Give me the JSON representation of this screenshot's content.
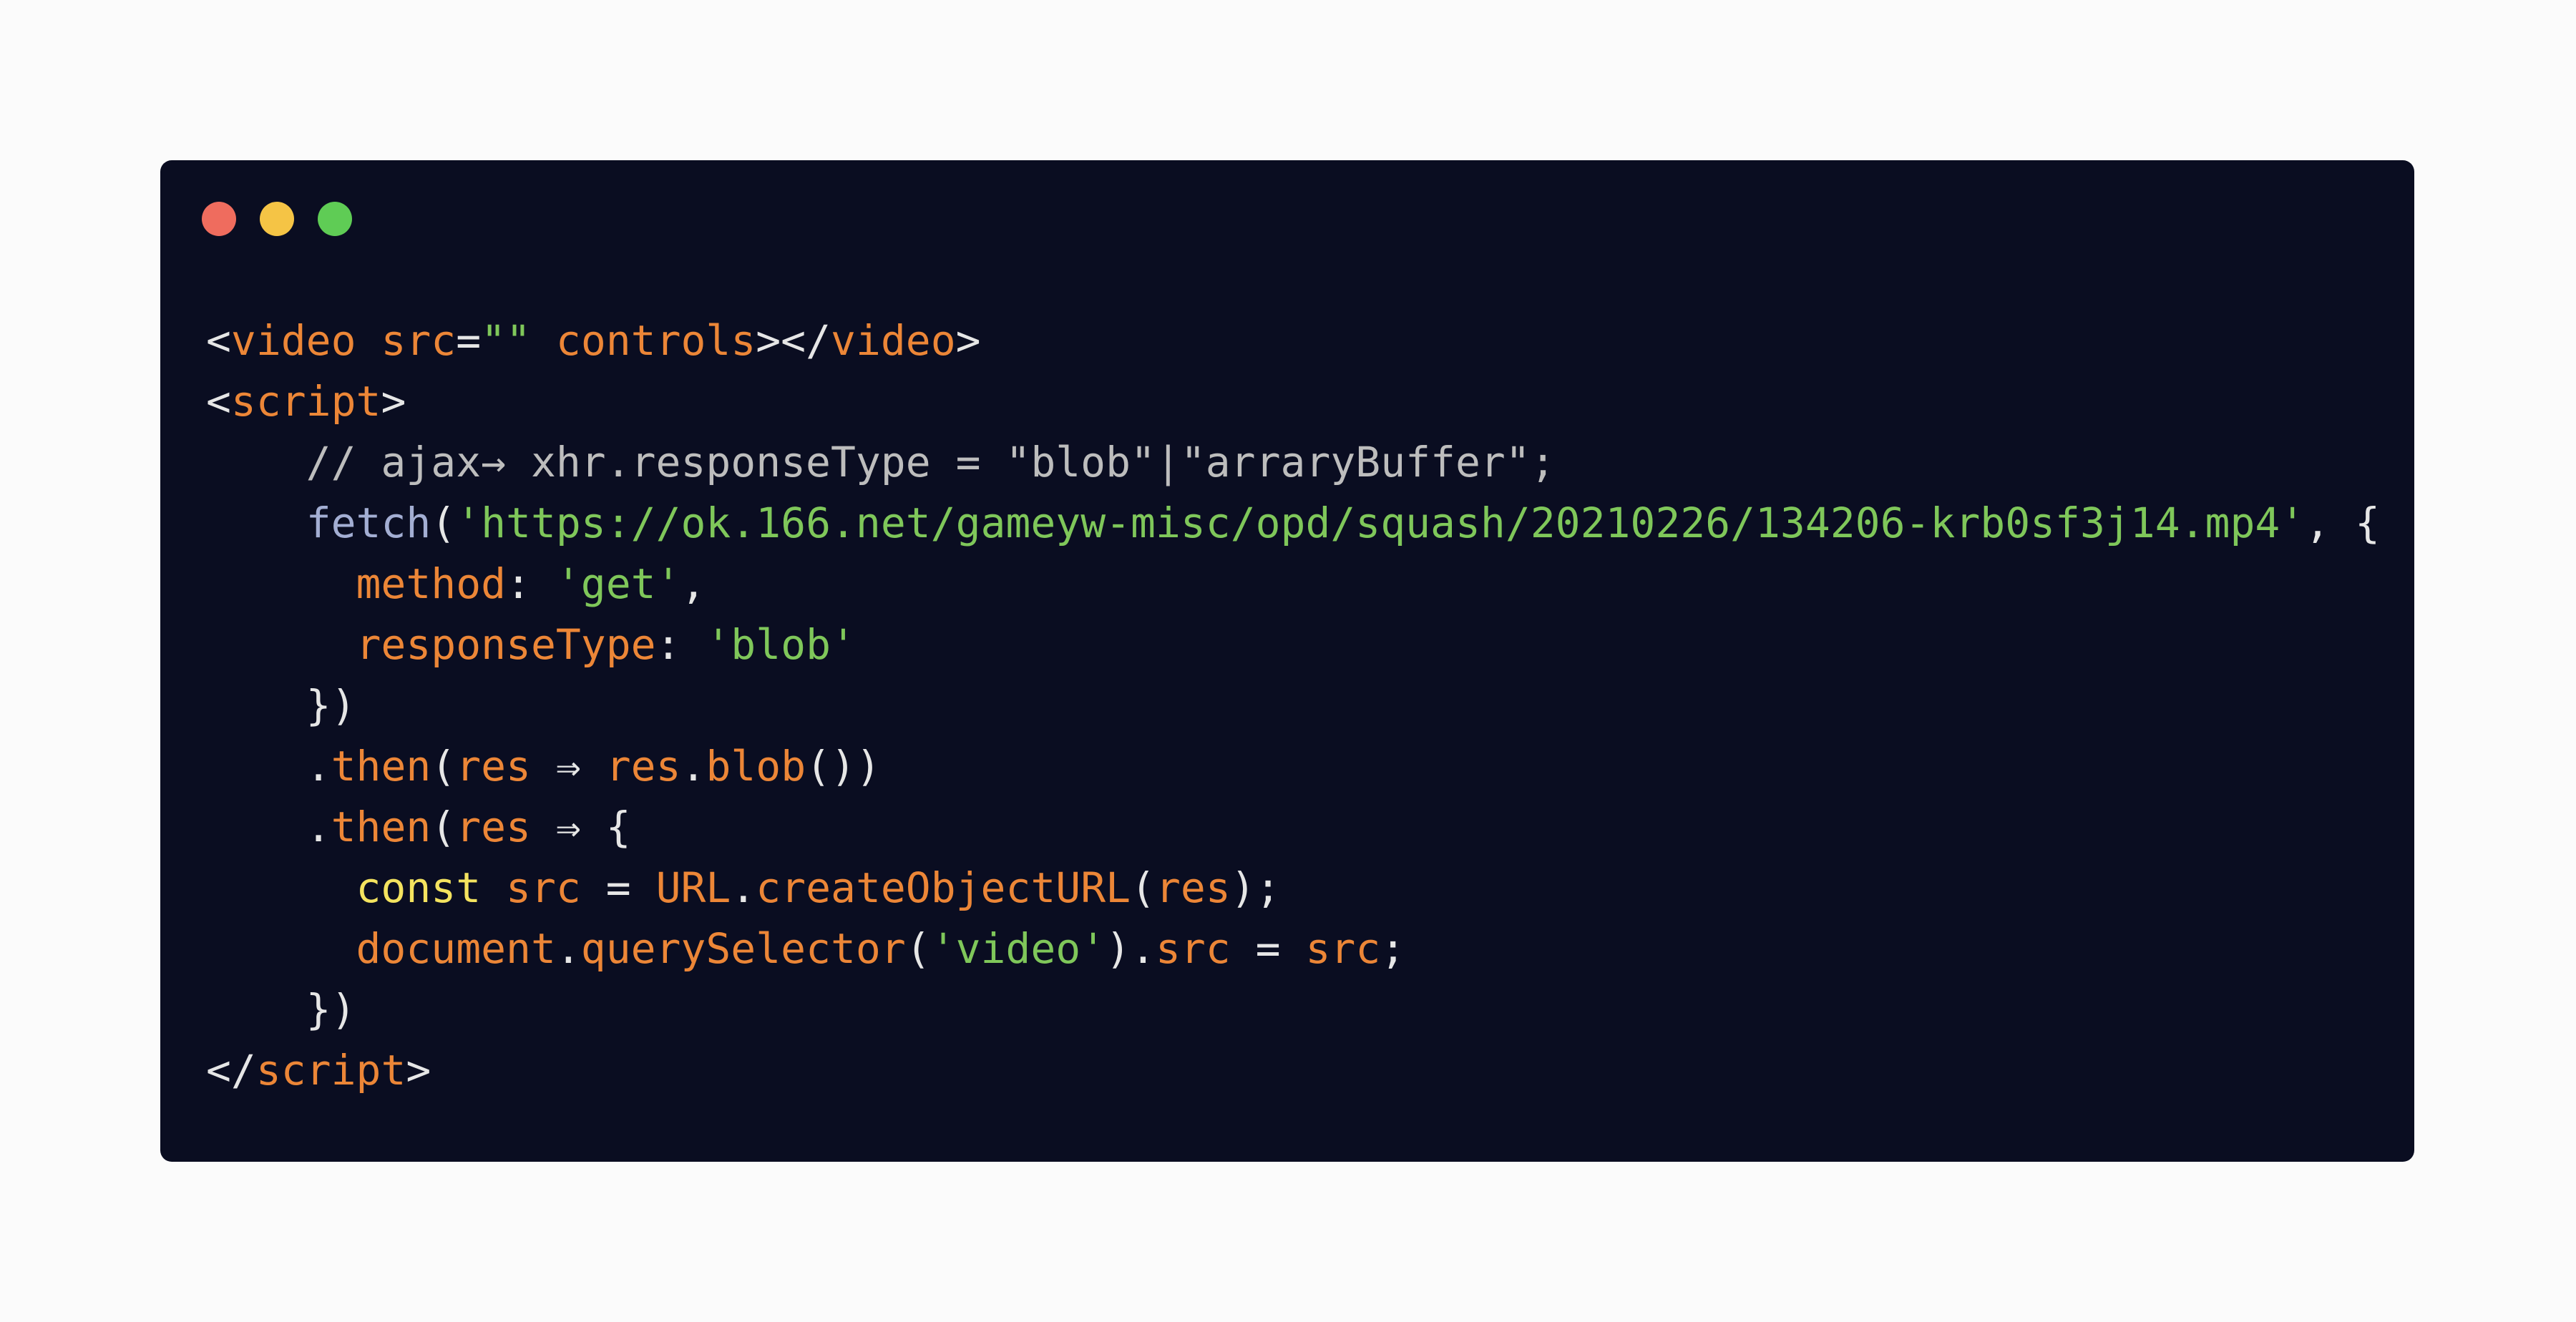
{
  "window": {
    "background": "#0a0d21",
    "traffic_lights": [
      {
        "name": "close",
        "color": "#ef6c5e"
      },
      {
        "name": "minimize",
        "color": "#f5c445"
      },
      {
        "name": "zoom",
        "color": "#5fcc55"
      }
    ]
  },
  "palette": {
    "plain": "#e6e6e6",
    "tag": "#ec8637",
    "attr": "#ec8637",
    "string": "#7fc75a",
    "comment": "#bdbdbd",
    "function": "#a3aed3",
    "keyword": "#f4e35f",
    "variable": "#ec8637"
  },
  "code_lines": [
    [
      {
        "t": "<",
        "c": "plain"
      },
      {
        "t": "video",
        "c": "tag"
      },
      {
        "t": " ",
        "c": "plain"
      },
      {
        "t": "src",
        "c": "attr"
      },
      {
        "t": "=",
        "c": "plain"
      },
      {
        "t": "\"\"",
        "c": "string"
      },
      {
        "t": " ",
        "c": "plain"
      },
      {
        "t": "controls",
        "c": "attr"
      },
      {
        "t": "></",
        "c": "plain"
      },
      {
        "t": "video",
        "c": "tag"
      },
      {
        "t": ">",
        "c": "plain"
      }
    ],
    [
      {
        "t": "<",
        "c": "plain"
      },
      {
        "t": "script",
        "c": "tag"
      },
      {
        "t": ">",
        "c": "plain"
      }
    ],
    [
      {
        "t": "    // ajax→ xhr.responseType = \"blob\"|\"arraryBuffer\";",
        "c": "comment"
      }
    ],
    [
      {
        "t": "    ",
        "c": "plain"
      },
      {
        "t": "fetch",
        "c": "function"
      },
      {
        "t": "(",
        "c": "plain"
      },
      {
        "t": "'https://ok.166.net/gameyw-misc/opd/squash/20210226/134206-krb0sf3j14.mp4'",
        "c": "string"
      },
      {
        "t": ", {",
        "c": "plain"
      }
    ],
    [
      {
        "t": "      ",
        "c": "plain"
      },
      {
        "t": "method",
        "c": "variable"
      },
      {
        "t": ": ",
        "c": "plain"
      },
      {
        "t": "'get'",
        "c": "string"
      },
      {
        "t": ",",
        "c": "plain"
      }
    ],
    [
      {
        "t": "      ",
        "c": "plain"
      },
      {
        "t": "responseType",
        "c": "variable"
      },
      {
        "t": ": ",
        "c": "plain"
      },
      {
        "t": "'blob'",
        "c": "string"
      }
    ],
    [
      {
        "t": "    })",
        "c": "plain"
      }
    ],
    [
      {
        "t": "    .",
        "c": "plain"
      },
      {
        "t": "then",
        "c": "variable"
      },
      {
        "t": "(",
        "c": "plain"
      },
      {
        "t": "res",
        "c": "variable"
      },
      {
        "t": " ⇒ ",
        "c": "plain"
      },
      {
        "t": "res",
        "c": "variable"
      },
      {
        "t": ".",
        "c": "plain"
      },
      {
        "t": "blob",
        "c": "variable"
      },
      {
        "t": "())",
        "c": "plain"
      }
    ],
    [
      {
        "t": "    .",
        "c": "plain"
      },
      {
        "t": "then",
        "c": "variable"
      },
      {
        "t": "(",
        "c": "plain"
      },
      {
        "t": "res",
        "c": "variable"
      },
      {
        "t": " ⇒ {",
        "c": "plain"
      }
    ],
    [
      {
        "t": "      ",
        "c": "plain"
      },
      {
        "t": "const",
        "c": "keyword"
      },
      {
        "t": " ",
        "c": "plain"
      },
      {
        "t": "src",
        "c": "variable"
      },
      {
        "t": " = ",
        "c": "plain"
      },
      {
        "t": "URL",
        "c": "variable"
      },
      {
        "t": ".",
        "c": "plain"
      },
      {
        "t": "createObjectURL",
        "c": "variable"
      },
      {
        "t": "(",
        "c": "plain"
      },
      {
        "t": "res",
        "c": "variable"
      },
      {
        "t": ");",
        "c": "plain"
      }
    ],
    [
      {
        "t": "      ",
        "c": "plain"
      },
      {
        "t": "document",
        "c": "variable"
      },
      {
        "t": ".",
        "c": "plain"
      },
      {
        "t": "querySelector",
        "c": "variable"
      },
      {
        "t": "(",
        "c": "plain"
      },
      {
        "t": "'video'",
        "c": "string"
      },
      {
        "t": ").",
        "c": "plain"
      },
      {
        "t": "src",
        "c": "variable"
      },
      {
        "t": " = ",
        "c": "plain"
      },
      {
        "t": "src",
        "c": "variable"
      },
      {
        "t": ";",
        "c": "plain"
      }
    ],
    [
      {
        "t": "    })",
        "c": "plain"
      }
    ],
    [
      {
        "t": "</",
        "c": "plain"
      },
      {
        "t": "script",
        "c": "tag"
      },
      {
        "t": ">",
        "c": "plain"
      }
    ]
  ]
}
